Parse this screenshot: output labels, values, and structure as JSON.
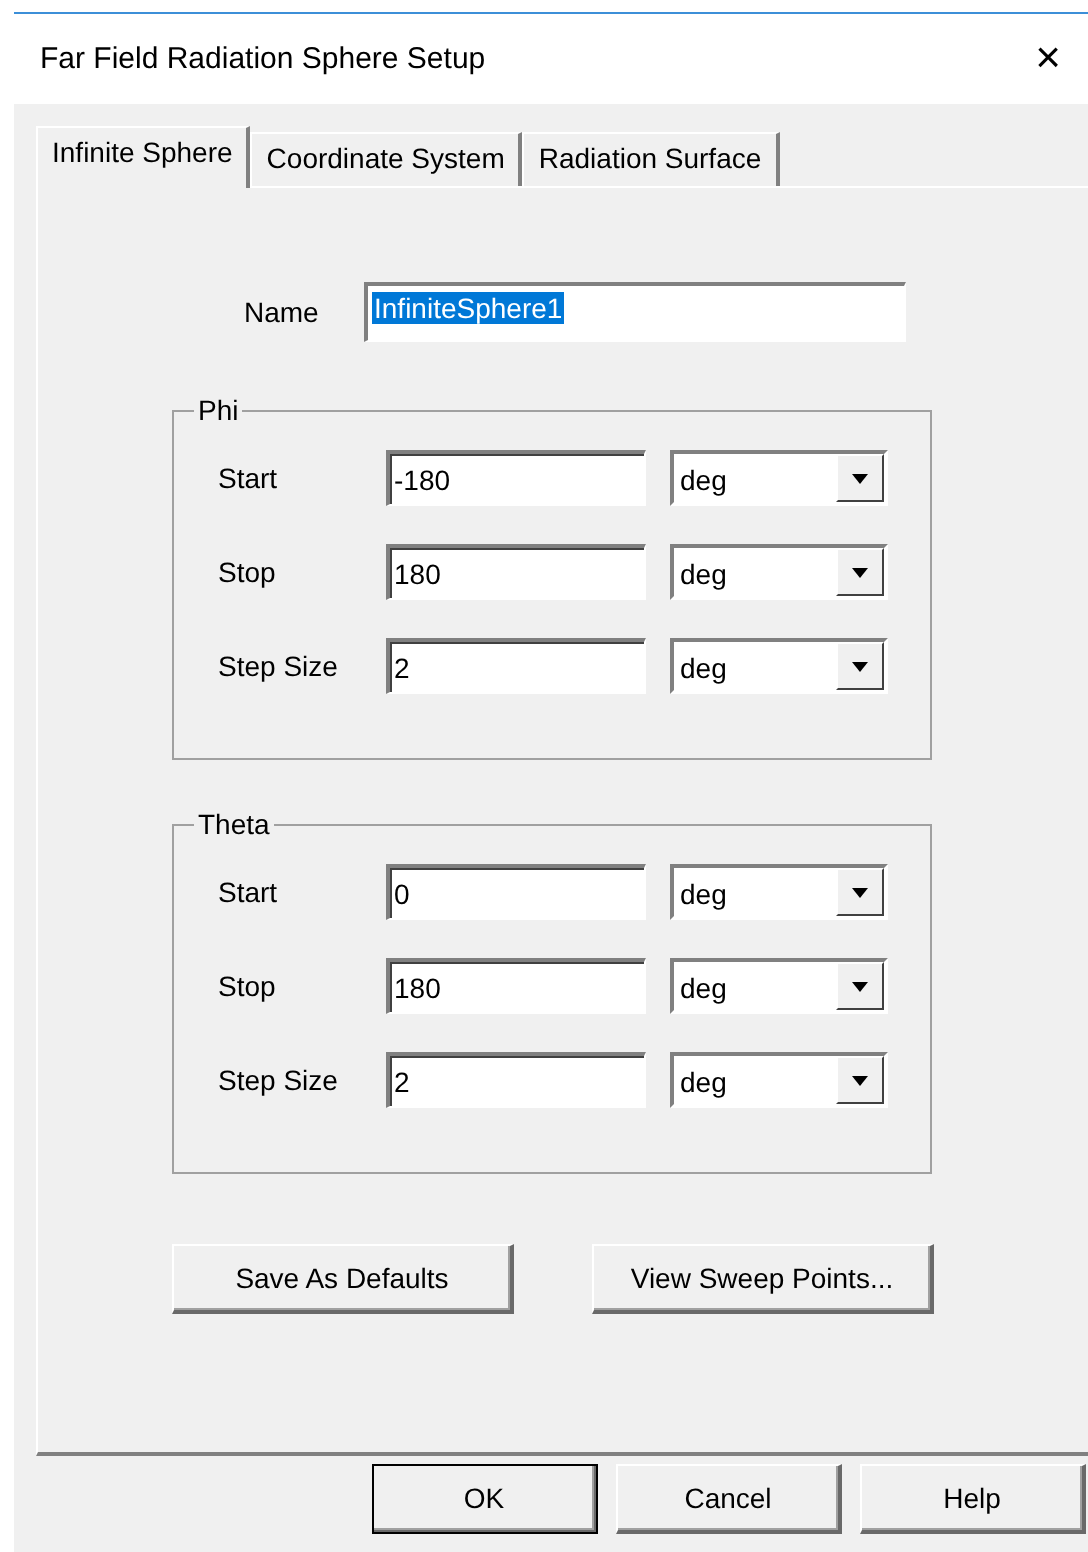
{
  "window": {
    "title": "Far Field Radiation Sphere Setup",
    "close": "×"
  },
  "tabs": [
    {
      "label": "Infinite Sphere",
      "selected": true
    },
    {
      "label": "Coordinate System",
      "selected": false
    },
    {
      "label": "Radiation Surface",
      "selected": false
    }
  ],
  "name_field": {
    "label": "Name",
    "value": "InfiniteSphere1",
    "text_selected": true
  },
  "groups": [
    {
      "title": "Phi",
      "rows": [
        {
          "label": "Start",
          "value": "-180",
          "unit": "deg"
        },
        {
          "label": "Stop",
          "value": "180",
          "unit": "deg"
        },
        {
          "label": "Step Size",
          "value": "2",
          "unit": "deg"
        }
      ]
    },
    {
      "title": "Theta",
      "rows": [
        {
          "label": "Start",
          "value": "0",
          "unit": "deg"
        },
        {
          "label": "Stop",
          "value": "180",
          "unit": "deg"
        },
        {
          "label": "Step Size",
          "value": "2",
          "unit": "deg"
        }
      ]
    }
  ],
  "panel_buttons": [
    "Save As Defaults",
    "View Sweep Points..."
  ],
  "dialog_buttons": [
    {
      "label": "OK",
      "default": true
    },
    {
      "label": "Cancel",
      "default": false
    },
    {
      "label": "Help",
      "default": false
    }
  ]
}
